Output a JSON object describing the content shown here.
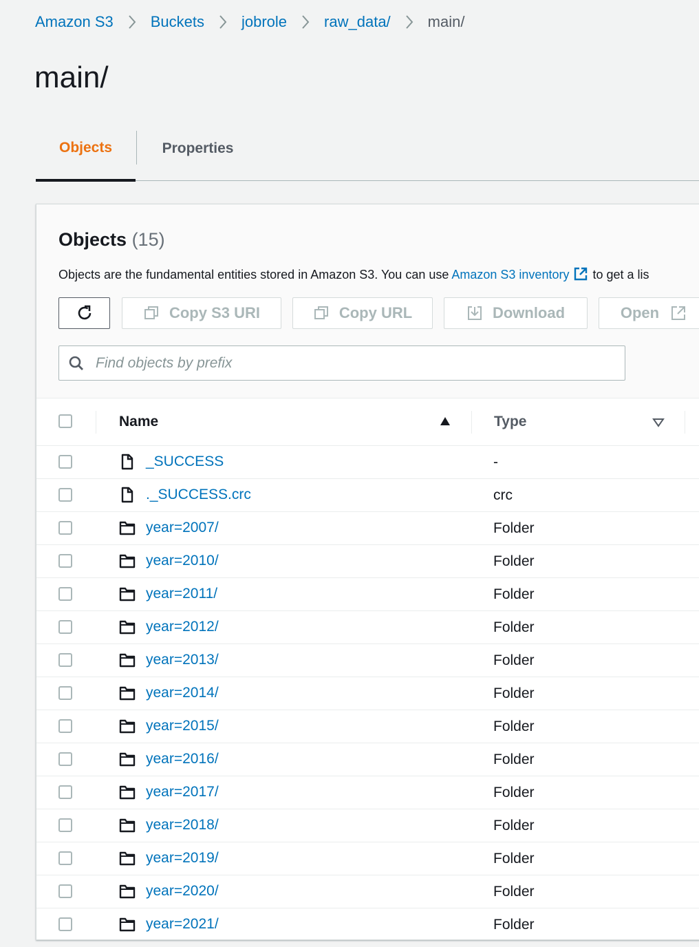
{
  "breadcrumb": {
    "items": [
      "Amazon S3",
      "Buckets",
      "jobrole",
      "raw_data/"
    ],
    "current": "main/"
  },
  "page": {
    "title": "main/"
  },
  "tabs": [
    {
      "label": "Objects",
      "active": true
    },
    {
      "label": "Properties",
      "active": false
    }
  ],
  "objects_panel": {
    "title": "Objects",
    "count": "(15)",
    "description_prefix": "Objects are the fundamental entities stored in Amazon S3. You can use ",
    "description_link": "Amazon S3 inventory",
    "description_suffix": "to get a lis"
  },
  "toolbar": {
    "refresh_icon": "refresh-icon",
    "copy_s3_uri": "Copy S3 URI",
    "copy_url": "Copy URL",
    "download": "Download",
    "open": "Open"
  },
  "search": {
    "placeholder": "Find objects by prefix",
    "value": ""
  },
  "table": {
    "columns": {
      "name": "Name",
      "type": "Type"
    },
    "rows": [
      {
        "name": "_SUCCESS",
        "type": "-",
        "icon": "file-icon"
      },
      {
        "name": "._SUCCESS.crc",
        "type": "crc",
        "icon": "file-icon"
      },
      {
        "name": "year=2007/",
        "type": "Folder",
        "icon": "folder-icon"
      },
      {
        "name": "year=2010/",
        "type": "Folder",
        "icon": "folder-icon"
      },
      {
        "name": "year=2011/",
        "type": "Folder",
        "icon": "folder-icon"
      },
      {
        "name": "year=2012/",
        "type": "Folder",
        "icon": "folder-icon"
      },
      {
        "name": "year=2013/",
        "type": "Folder",
        "icon": "folder-icon"
      },
      {
        "name": "year=2014/",
        "type": "Folder",
        "icon": "folder-icon"
      },
      {
        "name": "year=2015/",
        "type": "Folder",
        "icon": "folder-icon"
      },
      {
        "name": "year=2016/",
        "type": "Folder",
        "icon": "folder-icon"
      },
      {
        "name": "year=2017/",
        "type": "Folder",
        "icon": "folder-icon"
      },
      {
        "name": "year=2018/",
        "type": "Folder",
        "icon": "folder-icon"
      },
      {
        "name": "year=2019/",
        "type": "Folder",
        "icon": "folder-icon"
      },
      {
        "name": "year=2020/",
        "type": "Folder",
        "icon": "folder-icon"
      },
      {
        "name": "year=2021/",
        "type": "Folder",
        "icon": "folder-icon"
      }
    ]
  },
  "colors": {
    "link": "#0073bb",
    "active_tab": "#ec7211",
    "text": "#16191f",
    "disabled": "#aab7b8",
    "background": "#f2f3f3"
  }
}
